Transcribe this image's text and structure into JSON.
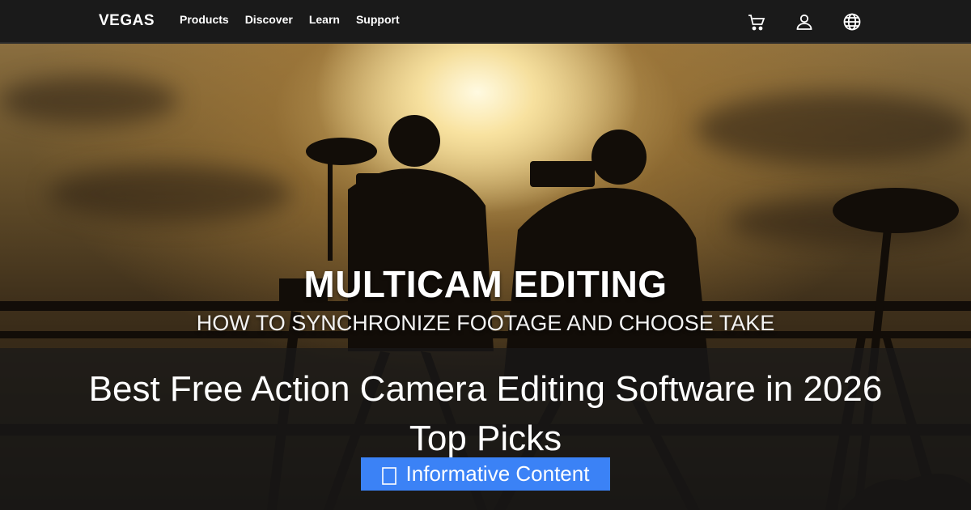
{
  "nav": {
    "logo": "VEGAS",
    "links": [
      "Products",
      "Discover",
      "Learn",
      "Support"
    ],
    "icons": [
      "cart-icon",
      "user-icon",
      "globe-icon"
    ]
  },
  "hero": {
    "title": "MULTICAM EDITING",
    "subtitle": "HOW TO SYNCHRONIZE FOOTAGE AND CHOOSE TAKE"
  },
  "headline": {
    "line1": "Best Free Action Camera Editing Software in 2026",
    "line2": "Top Picks"
  },
  "badge": {
    "icon": "document-icon",
    "label": "Informative Content",
    "color": "#3b82f6"
  }
}
